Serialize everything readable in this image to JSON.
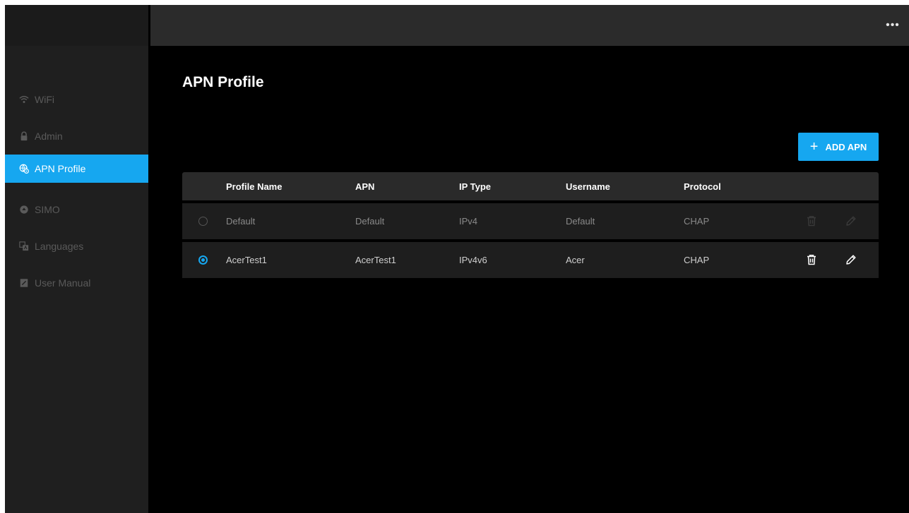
{
  "topbar": {
    "more_label": "•••"
  },
  "sidebar": {
    "items": [
      {
        "label": "WiFi",
        "icon": "wifi-icon",
        "active": false
      },
      {
        "label": "Admin",
        "icon": "lock-icon",
        "active": false
      },
      {
        "label": "APN Profile",
        "icon": "apn-globe-icon",
        "active": true
      },
      {
        "label": "SIMO",
        "icon": "simo-icon",
        "active": false
      },
      {
        "label": "Languages",
        "icon": "languages-icon",
        "active": false
      },
      {
        "label": "User Manual",
        "icon": "manual-icon",
        "active": false
      }
    ]
  },
  "main": {
    "title": "APN Profile",
    "add_button_label": "ADD APN",
    "add_button_icon": "plus-icon",
    "table": {
      "columns": [
        "Profile Name",
        "APN",
        "IP Type",
        "Username",
        "Protocol"
      ],
      "rows": [
        {
          "selected": false,
          "profile_name": "Default",
          "apn": "Default",
          "ip_type": "IPv4",
          "username": "Default",
          "protocol": "CHAP",
          "actions_enabled": false
        },
        {
          "selected": true,
          "profile_name": "AcerTest1",
          "apn": "AcerTest1",
          "ip_type": "IPv4v6",
          "username": "Acer",
          "protocol": "CHAP",
          "actions_enabled": true
        }
      ]
    }
  },
  "colors": {
    "accent": "#16a7f0",
    "background": "#000000",
    "sidebar": "#1f1f1f",
    "header": "#2b2b2b"
  }
}
